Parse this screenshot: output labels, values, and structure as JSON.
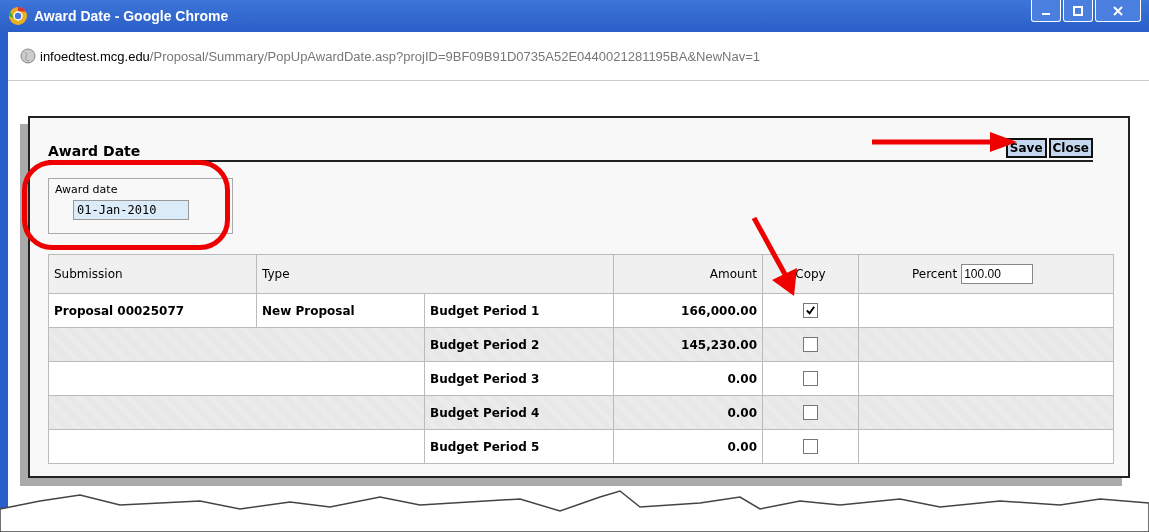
{
  "window": {
    "title": "Award Date - Google Chrome"
  },
  "address_bar": {
    "host": "infoedtest.mcg.edu",
    "path": "/Proposal/Summary/PopUpAwardDate.asp?projID=9BF09B91D0735A52E0440021281195BA&NewNav=1"
  },
  "panel": {
    "title": "Award Date",
    "buttons": [
      "Save",
      "Close"
    ]
  },
  "award_date": {
    "label": "Award date",
    "value": "01-Jan-2010"
  },
  "table": {
    "columns": [
      "Submission",
      "Type",
      "Amount",
      "Copy",
      "Percent"
    ],
    "percent_value": "100.00",
    "rows": [
      {
        "submission": "Proposal 00025077",
        "type": "New Proposal",
        "period": "Budget Period 1",
        "amount": "166,000.00",
        "copy": true
      },
      {
        "period": "Budget Period 2",
        "amount": "145,230.00",
        "copy": false
      },
      {
        "period": "Budget Period 3",
        "amount": "0.00",
        "copy": false
      },
      {
        "period": "Budget Period 4",
        "amount": "0.00",
        "copy": false
      },
      {
        "period": "Budget Period 5",
        "amount": "0.00",
        "copy": false
      }
    ]
  }
}
